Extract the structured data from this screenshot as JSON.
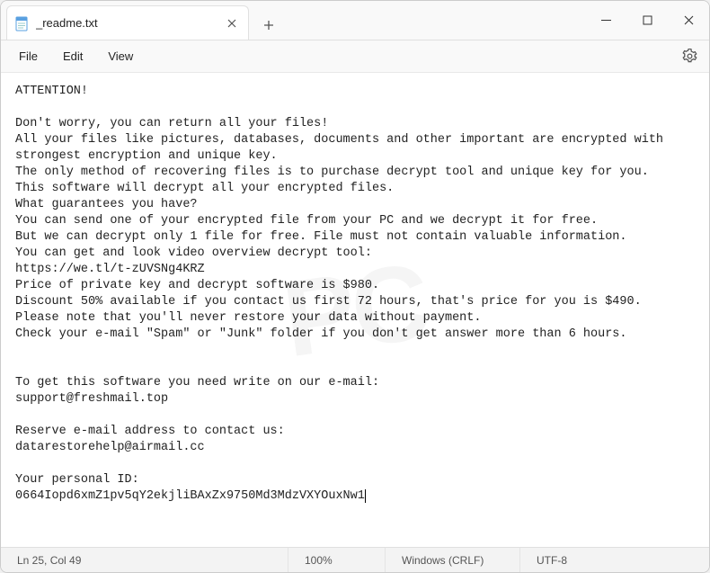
{
  "window": {
    "tab_title": "_readme.txt"
  },
  "menu": {
    "file": "File",
    "edit": "Edit",
    "view": "View"
  },
  "document": {
    "lines": [
      "ATTENTION!",
      "",
      "Don't worry, you can return all your files!",
      "All your files like pictures, databases, documents and other important are encrypted with strongest encryption and unique key.",
      "The only method of recovering files is to purchase decrypt tool and unique key for you.",
      "This software will decrypt all your encrypted files.",
      "What guarantees you have?",
      "You can send one of your encrypted file from your PC and we decrypt it for free.",
      "But we can decrypt only 1 file for free. File must not contain valuable information.",
      "You can get and look video overview decrypt tool:",
      "https://we.tl/t-zUVSNg4KRZ",
      "Price of private key and decrypt software is $980.",
      "Discount 50% available if you contact us first 72 hours, that's price for you is $490.",
      "Please note that you'll never restore your data without payment.",
      "Check your e-mail \"Spam\" or \"Junk\" folder if you don't get answer more than 6 hours.",
      "",
      "",
      "To get this software you need write on our e-mail:",
      "support@freshmail.top",
      "",
      "Reserve e-mail address to contact us:",
      "datarestorehelp@airmail.cc",
      "",
      "Your personal ID:",
      "0664Iopd6xmZ1pv5qY2ekjliBAxZx9750Md3MdzVXYOuxNw1"
    ]
  },
  "statusbar": {
    "position": "Ln 25, Col 49",
    "zoom": "100%",
    "eol": "Windows (CRLF)",
    "encoding": "UTF-8"
  }
}
